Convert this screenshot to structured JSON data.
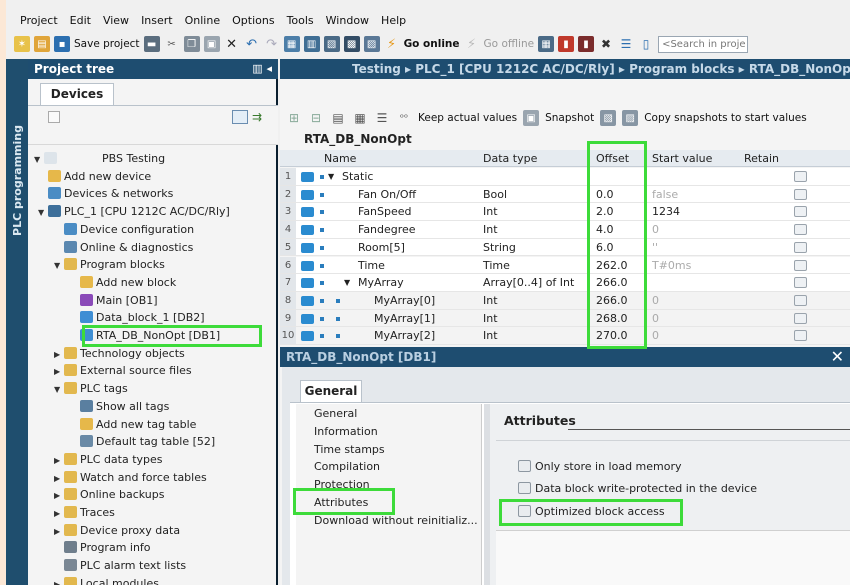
{
  "menu": [
    "Project",
    "Edit",
    "View",
    "Insert",
    "Online",
    "Options",
    "Tools",
    "Window",
    "Help"
  ],
  "toolbar": {
    "save_project": "Save project",
    "go_online": "Go online",
    "go_offline": "Go offline",
    "search_placeholder": "<Search in proje"
  },
  "side_tab": "PLC programming",
  "project_tree": {
    "header": "Project tree",
    "tab": "Devices",
    "items": [
      {
        "label": "PBS Testing",
        "level": 0,
        "arrow": "▼",
        "icon": "document-icon"
      },
      {
        "label": "Add new device",
        "level": 1,
        "arrow": "",
        "icon": "add-device-icon"
      },
      {
        "label": "Devices & networks",
        "level": 1,
        "arrow": "",
        "icon": "network-icon"
      },
      {
        "label": "PLC_1 [CPU 1212C AC/DC/Rly]",
        "level": 1,
        "arrow": "▼",
        "icon": "plc-icon"
      },
      {
        "label": "Device configuration",
        "level": 2,
        "arrow": "",
        "icon": "device-config-icon"
      },
      {
        "label": "Online & diagnostics",
        "level": 2,
        "arrow": "",
        "icon": "diagnostics-icon"
      },
      {
        "label": "Program blocks",
        "level": 2,
        "arrow": "▼",
        "icon": "folder-icon"
      },
      {
        "label": "Add new block",
        "level": 3,
        "arrow": "",
        "icon": "add-block-icon"
      },
      {
        "label": "Main [OB1]",
        "level": 3,
        "arrow": "",
        "icon": "ob-icon"
      },
      {
        "label": "Data_block_1 [DB2]",
        "level": 3,
        "arrow": "",
        "icon": "db-icon"
      },
      {
        "label": "RTA_DB_NonOpt [DB1]",
        "level": 3,
        "arrow": "",
        "icon": "db-icon"
      },
      {
        "label": "Technology objects",
        "level": 2,
        "arrow": "▶",
        "icon": "folder-icon"
      },
      {
        "label": "External source files",
        "level": 2,
        "arrow": "▶",
        "icon": "folder-icon"
      },
      {
        "label": "PLC tags",
        "level": 2,
        "arrow": "▼",
        "icon": "folder-icon"
      },
      {
        "label": "Show all tags",
        "level": 3,
        "arrow": "",
        "icon": "tags-icon"
      },
      {
        "label": "Add new tag table",
        "level": 3,
        "arrow": "",
        "icon": "add-tag-icon"
      },
      {
        "label": "Default tag table [52]",
        "level": 3,
        "arrow": "",
        "icon": "tag-table-icon"
      },
      {
        "label": "PLC data types",
        "level": 2,
        "arrow": "▶",
        "icon": "folder-icon"
      },
      {
        "label": "Watch and force tables",
        "level": 2,
        "arrow": "▶",
        "icon": "folder-icon"
      },
      {
        "label": "Online backups",
        "level": 2,
        "arrow": "▶",
        "icon": "folder-icon"
      },
      {
        "label": "Traces",
        "level": 2,
        "arrow": "▶",
        "icon": "folder-icon"
      },
      {
        "label": "Device proxy data",
        "level": 2,
        "arrow": "▶",
        "icon": "folder-icon"
      },
      {
        "label": "Program info",
        "level": 2,
        "arrow": "",
        "icon": "info-icon"
      },
      {
        "label": "PLC alarm text lists",
        "level": 2,
        "arrow": "",
        "icon": "alarm-list-icon"
      },
      {
        "label": "Local modules",
        "level": 2,
        "arrow": "▶",
        "icon": "folder-icon"
      }
    ]
  },
  "breadcrumb": "Testing  ▸  PLC_1 [CPU 1212C AC/DC/Rly]  ▸  Program blocks  ▸  RTA_DB_NonOpt [D",
  "editor": {
    "keep_actual_values": "Keep actual values",
    "snapshot": "Snapshot",
    "copy_snapshots": "Copy snapshots to start values",
    "block_title": "RTA_DB_NonOpt",
    "columns": {
      "name": "Name",
      "data_type": "Data type",
      "offset": "Offset",
      "start_value": "Start value",
      "retain": "Retain"
    },
    "rows": [
      {
        "num": "1",
        "arrow": "▼",
        "name": "Static",
        "type": "",
        "offset": "",
        "start": "",
        "indent": 0
      },
      {
        "num": "2",
        "arrow": "",
        "name": "Fan On/Off",
        "type": "Bool",
        "offset": "0.0",
        "start": "false",
        "indent": 1
      },
      {
        "num": "3",
        "arrow": "",
        "name": "FanSpeed",
        "type": "Int",
        "offset": "2.0",
        "start": "1234",
        "indent": 1
      },
      {
        "num": "4",
        "arrow": "",
        "name": "Fandegree",
        "type": "Int",
        "offset": "4.0",
        "start": "0",
        "indent": 1
      },
      {
        "num": "5",
        "arrow": "",
        "name": "Room[5]",
        "type": "String",
        "offset": "6.0",
        "start": "''",
        "indent": 1
      },
      {
        "num": "6",
        "arrow": "",
        "name": "Time",
        "type": "Time",
        "offset": "262.0",
        "start": "T#0ms",
        "indent": 1
      },
      {
        "num": "7",
        "arrow": "▼",
        "name": "MyArray",
        "type": "Array[0..4] of Int",
        "offset": "266.0",
        "start": "",
        "indent": 1
      },
      {
        "num": "8",
        "arrow": "",
        "name": "MyArray[0]",
        "type": "Int",
        "offset": "266.0",
        "start": "0",
        "indent": 2
      },
      {
        "num": "9",
        "arrow": "",
        "name": "MyArray[1]",
        "type": "Int",
        "offset": "268.0",
        "start": "0",
        "indent": 2
      },
      {
        "num": "10",
        "arrow": "",
        "name": "MyArray[2]",
        "type": "Int",
        "offset": "270.0",
        "start": "0",
        "indent": 2
      }
    ]
  },
  "dialog": {
    "title": "RTA_DB_NonOpt [DB1]",
    "tab": "General",
    "nav": [
      "General",
      "Information",
      "Time stamps",
      "Compilation",
      "Protection",
      "Attributes",
      "Download without reinitializ..."
    ],
    "attributes_header": "Attributes",
    "options": [
      {
        "label": "Only store in load memory",
        "checked": false
      },
      {
        "label": "Data block write-protected in the device",
        "checked": false
      },
      {
        "label": "Optimized block access",
        "checked": false
      }
    ]
  },
  "highlight_color": "#3ddb3a"
}
